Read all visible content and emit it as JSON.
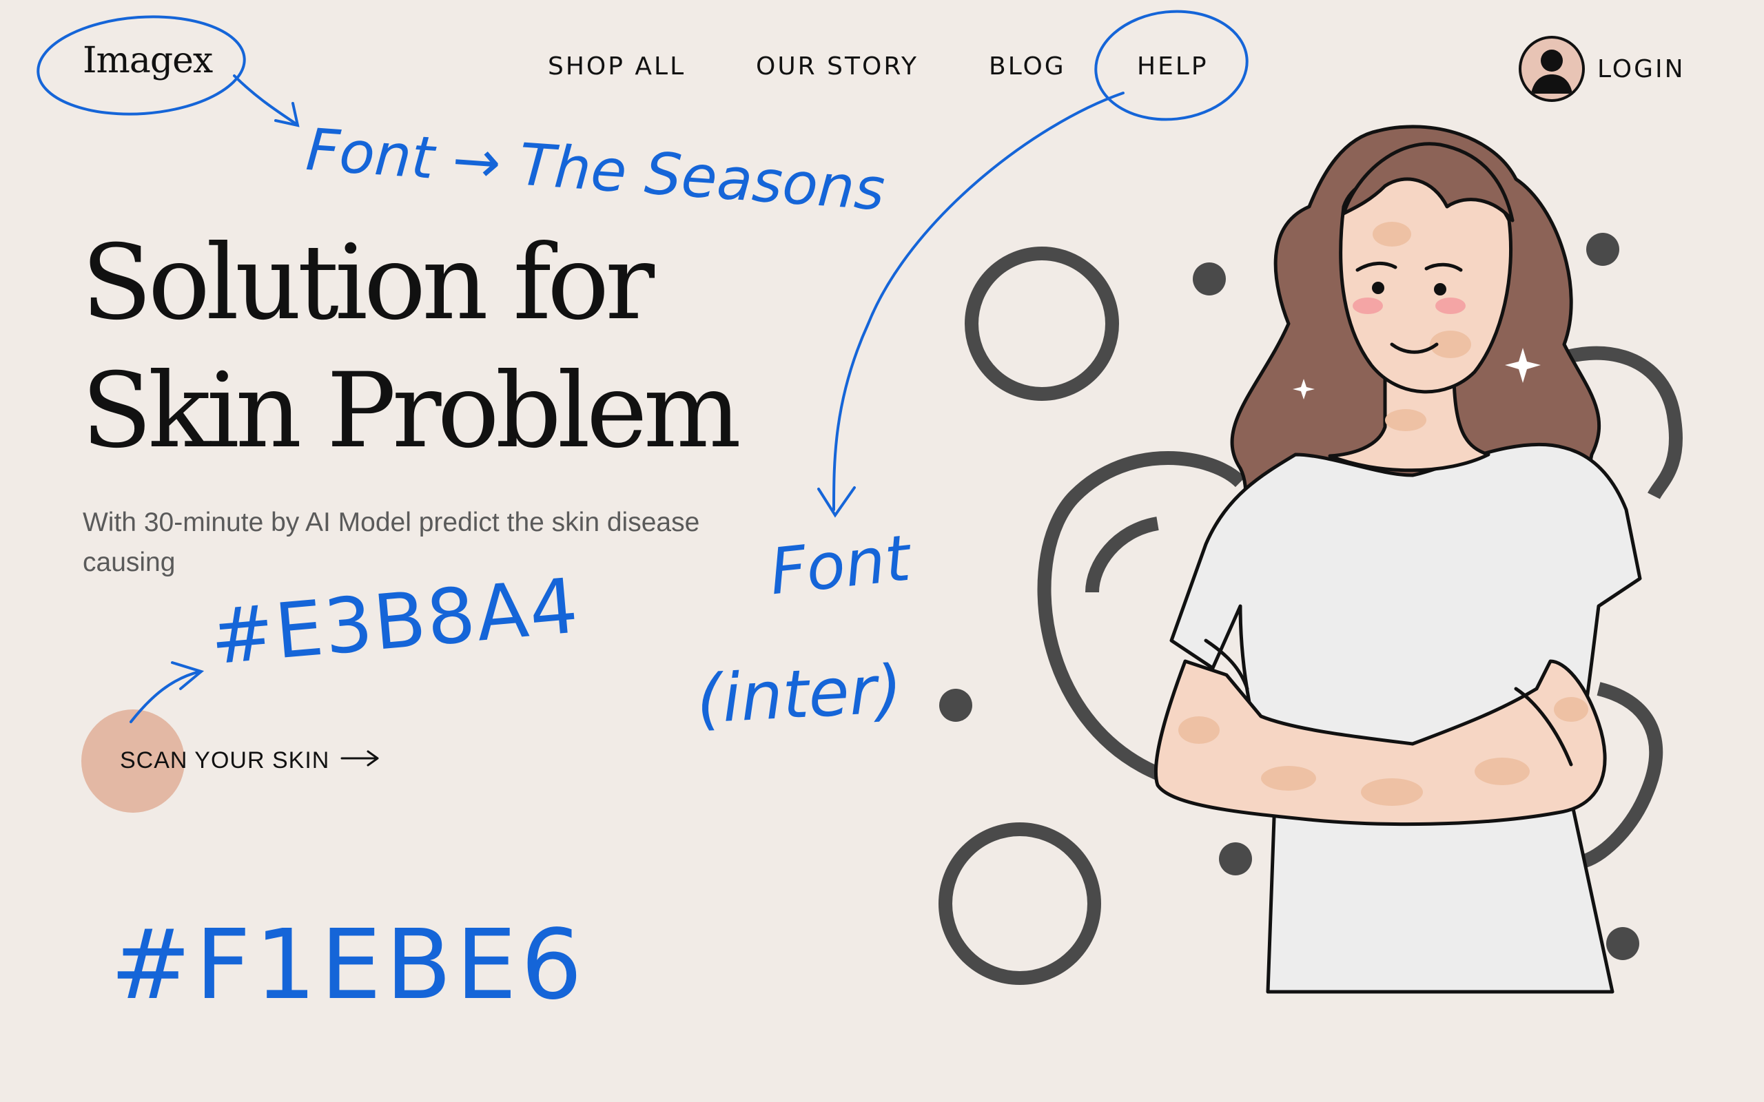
{
  "brand": {
    "logo_text": "Imagex"
  },
  "nav": {
    "items": [
      {
        "label": "SHOP ALL"
      },
      {
        "label": "OUR STORY"
      },
      {
        "label": "BLOG"
      },
      {
        "label": "HELP"
      }
    ],
    "login_label": "LOGIN"
  },
  "hero": {
    "title_line1": "Solution for",
    "title_line2": "Skin Problem",
    "subtitle": "With 30-minute by AI Model predict the skin disease causing",
    "cta_label": "SCAN YOUR SKIN"
  },
  "annotations": {
    "font_seasons": "Font → The Seasons",
    "cta_color": "#E3B8A4",
    "font_label": "Font",
    "font_inter": "(inter)",
    "bg_color": "#F1EBE6"
  },
  "colors": {
    "background": "#F1EBE6",
    "accent": "#E3B8A4",
    "annotation_ink": "#1565D8",
    "text": "#111111"
  },
  "icons": {
    "user": "user-avatar-icon",
    "arrow": "arrow-right-icon"
  }
}
